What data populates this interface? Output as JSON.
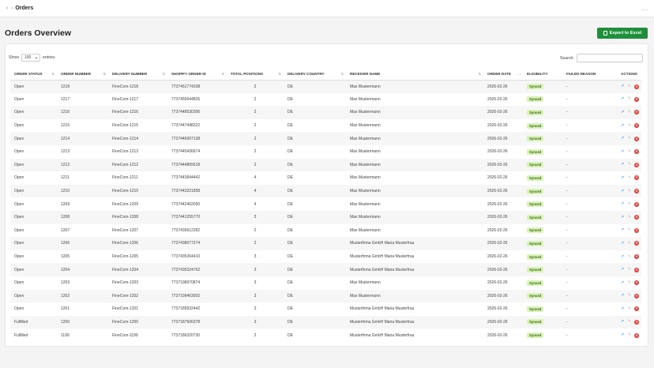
{
  "header": {
    "breadcrumb_sep": "›",
    "current": "Orders",
    "more": "..."
  },
  "page": {
    "title": "Orders Overview",
    "export_label": "Export to Excel"
  },
  "controls": {
    "show_label": "Show",
    "entries_value": "100",
    "entries_label": "entries",
    "search_label": "Search:"
  },
  "table": {
    "columns": [
      "ORDER STATUS",
      "ORDER NUMBER",
      "DELIVERY NUMBER",
      "SHOPIFY ORDER ID",
      "TOTAL POSITIONS",
      "DELIVERY COUNTRY",
      "RECEIVER NAME",
      "ORDER DATE",
      "ELIGIBILITY",
      "FAILED REASON",
      "ACTIONS"
    ],
    "rows": [
      [
        "Open",
        "1218",
        "FineCom-1218",
        "7737451774208",
        "2",
        "DE",
        "Max Mustermann",
        "2026-02-26",
        "Synced",
        "-"
      ],
      [
        "Open",
        "1217",
        "FineCom-1217",
        "7737450644826",
        "2",
        "DE",
        "Max Mustermann",
        "2026-02-26",
        "Synced",
        "-"
      ],
      [
        "Open",
        "1216",
        "FineCom-1216",
        "7737448530306",
        "2",
        "DE",
        "Max Mustermann",
        "2026-02-26",
        "Synced",
        "-"
      ],
      [
        "Open",
        "1215",
        "FineCom-1215",
        "7737447448322",
        "2",
        "DE",
        "Max Mustermann",
        "2026-02-26",
        "Synced",
        "-"
      ],
      [
        "Open",
        "1214",
        "FineCom-1214",
        "7737446007138",
        "2",
        "DE",
        "Max Mustermann",
        "2026-02-26",
        "Synced",
        "-"
      ],
      [
        "Open",
        "1213",
        "FineCom-1213",
        "7737445436674",
        "2",
        "DE",
        "Max Mustermann",
        "2026-02-26",
        "Synced",
        "-"
      ],
      [
        "Open",
        "1212",
        "FineCom-1212",
        "7737444865618",
        "2",
        "DE",
        "Max Mustermann",
        "2026-02-26",
        "Synced",
        "-"
      ],
      [
        "Open",
        "1211",
        "FineCom-1211",
        "7737443844442",
        "4",
        "DE",
        "Max Mustermann",
        "2026-02-26",
        "Synced",
        "-"
      ],
      [
        "Open",
        "1210",
        "FineCom-1210",
        "7737443221858",
        "4",
        "DE",
        "Max Mustermann",
        "2026-02-26",
        "Synced",
        "-"
      ],
      [
        "Open",
        "1209",
        "FineCom-1209",
        "7737442402050",
        "4",
        "DE",
        "Max Mustermann",
        "2026-02-26",
        "Synced",
        "-"
      ],
      [
        "Open",
        "1208",
        "FineCom-1208",
        "7737441255770",
        "3",
        "DE",
        "Max Mustermann",
        "2026-02-26",
        "Synced",
        "-"
      ],
      [
        "Open",
        "1207",
        "FineCom-1207",
        "7737439612282",
        "2",
        "DE",
        "Max Mustermann",
        "2026-02-26",
        "Synced",
        "-"
      ],
      [
        "Open",
        "1206",
        "FineCom-1206",
        "7737438077274",
        "2",
        "DE",
        "Musterfirma GmbH Maria Musterfrau",
        "2026-02-26",
        "Synced",
        "-"
      ],
      [
        "Open",
        "1205",
        "FineCom-1205",
        "7737435264410",
        "3",
        "DE",
        "Musterfirma GmbH Maria Musterfrau",
        "2026-02-26",
        "Synced",
        "-"
      ],
      [
        "Open",
        "1204",
        "FineCom-1204",
        "7737435324762",
        "3",
        "DE",
        "Musterfirma GmbH Maria Musterfrau",
        "2026-02-26",
        "Synced",
        "-"
      ],
      [
        "Open",
        "1203",
        "FineCom-1203",
        "7737198970874",
        "3",
        "DE",
        "Max Mustermann",
        "2026-02-26",
        "Synced",
        "-"
      ],
      [
        "Open",
        "1202",
        "FineCom-1202",
        "7737199463002",
        "3",
        "DE",
        "Max Mustermann",
        "2026-02-26",
        "Synced",
        "-"
      ],
      [
        "Open",
        "1201",
        "FineCom-1201",
        "7737189932442",
        "3",
        "DE",
        "Musterfirma GmbH Maria Musterfrau",
        "2026-02-26",
        "Synced",
        "-"
      ],
      [
        "Fulfilled",
        "1200",
        "FineCom-1200",
        "7737187506378",
        "3",
        "DE",
        "Musterfirma GmbH Maria Musterfrau",
        "2026-02-26",
        "Synced",
        "-"
      ],
      [
        "Fulfilled",
        "1199",
        "FineCom-1199",
        "7737186320730",
        "2",
        "DE",
        "Musterfirma GmbH Maria Musterfrau",
        "2026-02-26",
        "Synced",
        "-"
      ]
    ]
  },
  "icons": {
    "back": "back-arrow-icon",
    "open": "external-link-icon",
    "edit": "edit-icon",
    "delete": "delete-icon"
  },
  "colors": {
    "accent": "#1f8f3c",
    "badge_bg": "#d9f2b8",
    "delete": "#e53935",
    "link": "#1976d2"
  }
}
